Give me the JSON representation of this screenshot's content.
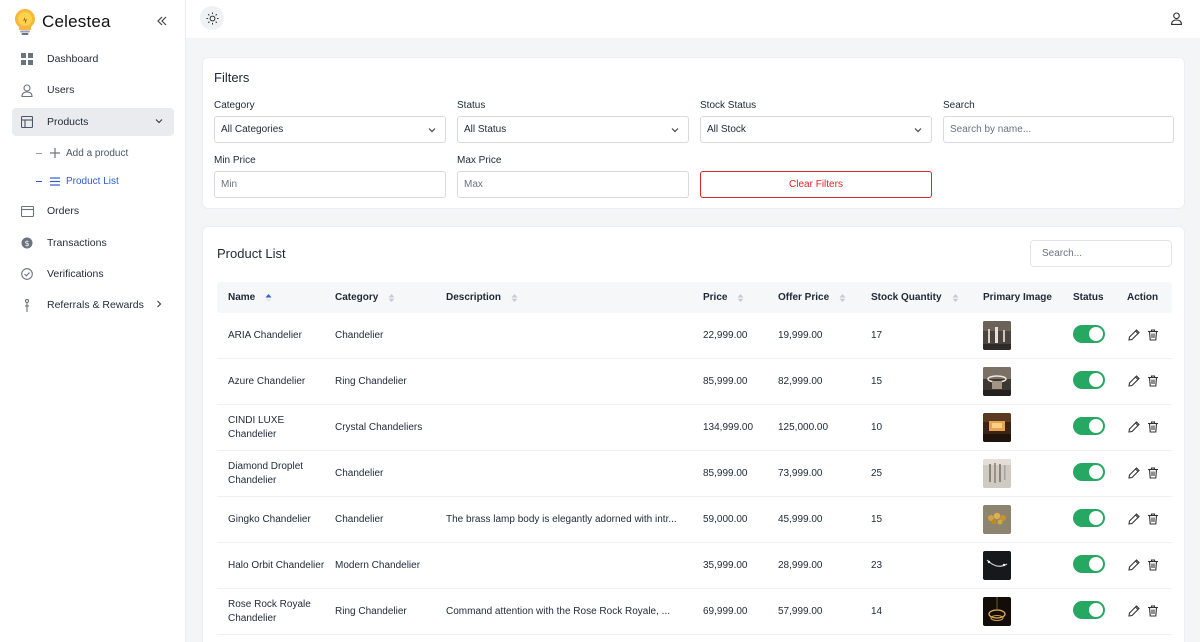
{
  "app": {
    "name": "Celestea"
  },
  "sidebar": {
    "items": [
      {
        "label": "Dashboard",
        "icon": "grid-icon"
      },
      {
        "label": "Users",
        "icon": "user-icon"
      },
      {
        "label": "Products",
        "icon": "table-icon",
        "expanded": true
      },
      {
        "label": "Orders",
        "icon": "card-icon"
      },
      {
        "label": "Transactions",
        "icon": "dollar-icon"
      },
      {
        "label": "Verifications",
        "icon": "check-circle-icon"
      },
      {
        "label": "Referrals & Rewards",
        "icon": "referral-icon"
      }
    ],
    "sub_items": [
      {
        "label": "Add a product",
        "icon": "plus-icon"
      },
      {
        "label": "Product List",
        "icon": "list-icon",
        "active": true
      }
    ]
  },
  "filters": {
    "title": "Filters",
    "category": {
      "label": "Category",
      "value": "All Categories"
    },
    "status": {
      "label": "Status",
      "value": "All Status"
    },
    "stock_status": {
      "label": "Stock Status",
      "value": "All Stock"
    },
    "search": {
      "label": "Search",
      "placeholder": "Search by name..."
    },
    "min_price": {
      "label": "Min Price",
      "placeholder": "Min"
    },
    "max_price": {
      "label": "Max Price",
      "placeholder": "Max"
    },
    "clear_label": "Clear Filters"
  },
  "product_list": {
    "title": "Product List",
    "search_placeholder": "Search...",
    "columns": [
      "Name",
      "Category",
      "Description",
      "Price",
      "Offer Price",
      "Stock Quantity",
      "Primary Image",
      "Status",
      "Action"
    ],
    "rows": [
      {
        "name": "ARIA Chandelier",
        "category": "Chandelier",
        "description": "",
        "price": "22,999.00",
        "offer_price": "19,999.00",
        "stock": "17",
        "status_on": true
      },
      {
        "name": "Azure Chandelier",
        "category": "Ring Chandelier",
        "description": "",
        "price": "85,999.00",
        "offer_price": "82,999.00",
        "stock": "15",
        "status_on": true
      },
      {
        "name": "CINDI LUXE Chandelier",
        "category": "Crystal Chandeliers",
        "description": "",
        "price": "134,999.00",
        "offer_price": "125,000.00",
        "stock": "10",
        "status_on": true
      },
      {
        "name": "Diamond Droplet Chandelier",
        "category": "Chandelier",
        "description": "",
        "price": "85,999.00",
        "offer_price": "73,999.00",
        "stock": "25",
        "status_on": true
      },
      {
        "name": "Gingko Chandelier",
        "category": "Chandelier",
        "description": "The brass lamp body is elegantly adorned with intr...",
        "price": "59,000.00",
        "offer_price": "45,999.00",
        "stock": "15",
        "status_on": true
      },
      {
        "name": "Halo Orbit Chandelier",
        "category": "Modern Chandelier",
        "description": "",
        "price": "35,999.00",
        "offer_price": "28,999.00",
        "stock": "23",
        "status_on": true
      },
      {
        "name": "Rose Rock Royale Chandelier",
        "category": "Ring Chandelier",
        "description": "Command attention with the Rose Rock Royale, ...",
        "price": "69,999.00",
        "offer_price": "57,999.00",
        "stock": "14",
        "status_on": true
      }
    ]
  },
  "colors": {
    "accent": "#2f5bd7",
    "toggle_on": "#27a862",
    "danger": "#dc2626",
    "logo": "#f2a516"
  }
}
